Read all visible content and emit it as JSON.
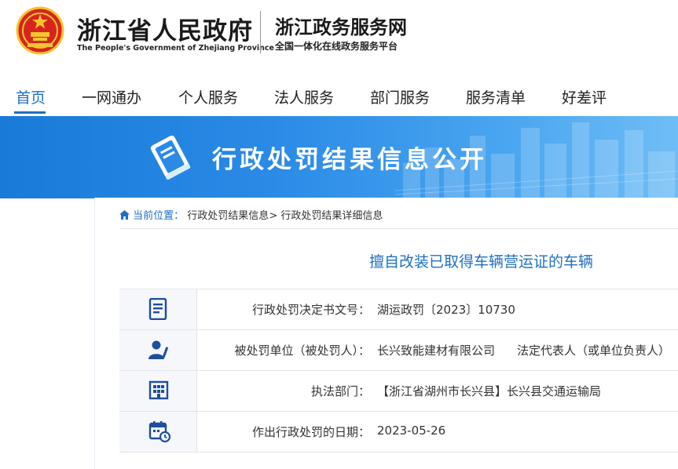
{
  "header": {
    "gov_title": "浙江省人民政府",
    "gov_subtitle": "The People's Government of Zhejiang Province",
    "site_title": "浙江政务服务网",
    "site_subtitle": "全国一体化在线政务服务平台"
  },
  "nav": {
    "items": [
      "首页",
      "一网通办",
      "个人服务",
      "法人服务",
      "部门服务",
      "服务清单",
      "好差评"
    ],
    "active_index": 0
  },
  "banner": {
    "title": "行政处罚结果信息公开"
  },
  "breadcrumb": {
    "home_label": "当前位置：",
    "level1": "行政处罚结果信息",
    "separator": ">",
    "level2": "行政处罚结果详细信息"
  },
  "record": {
    "title": "擅自改装已取得车辆营运证的车辆",
    "rows": [
      {
        "icon": "document-icon",
        "label": "行政处罚决定书文号：",
        "value": "湖运政罚〔2023〕10730",
        "extra": ""
      },
      {
        "icon": "person-icon",
        "label": "被处罚单位（被处罚人）：",
        "value": "长兴致能建材有限公司",
        "extra": "法定代表人（或单位负责人）"
      },
      {
        "icon": "building-icon",
        "label": "执法部门：",
        "value": "【浙江省湖州市长兴县】长兴县交通运输局",
        "extra": ""
      },
      {
        "icon": "calendar-icon",
        "label": "作出行政处罚的日期：",
        "value": "2023-05-26",
        "extra": ""
      }
    ]
  },
  "colors": {
    "accent": "#1f6fc4",
    "banner": "#2a8ae6",
    "emblem_red": "#d8241e",
    "emblem_gold": "#f4c430"
  }
}
